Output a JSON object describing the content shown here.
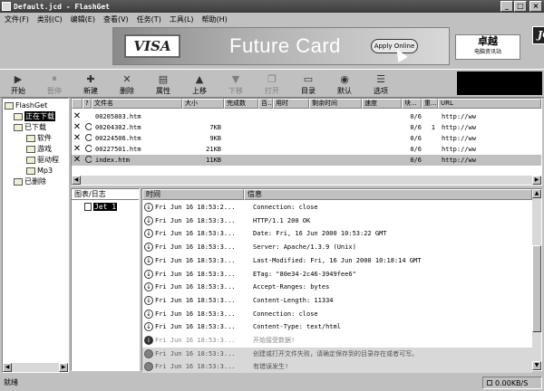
{
  "window": {
    "title": "Default.jcd - FlashGet",
    "buttons": [
      "_",
      "□",
      "×"
    ]
  },
  "menu": [
    "文件(F)",
    "类别(C)",
    "编辑(E)",
    "查看(V)",
    "任务(T)",
    "工具(L)",
    "帮助(H)"
  ],
  "banner": {
    "visa": "VISA",
    "headline": "Future Card",
    "apply": "Apply Online",
    "jc_logo": "JC",
    "zhuoyue_big": "卓越",
    "zhuoyue_small": "电脑资讯站"
  },
  "toolbar": [
    {
      "label": "开始",
      "icon": "play-icon",
      "glyph": "▶",
      "enabled": true
    },
    {
      "label": "暂停",
      "icon": "pause-icon",
      "glyph": "⏸",
      "enabled": false
    },
    {
      "label": "新建",
      "icon": "new-icon",
      "glyph": "✚",
      "enabled": true
    },
    {
      "label": "删除",
      "icon": "delete-icon",
      "glyph": "✕",
      "enabled": true
    },
    {
      "label": "属性",
      "icon": "properties-icon",
      "glyph": "▤",
      "enabled": true
    },
    {
      "label": "上移",
      "icon": "move-up-icon",
      "glyph": "▲",
      "enabled": true
    },
    {
      "label": "下移",
      "icon": "move-down-icon",
      "glyph": "▼",
      "enabled": false
    },
    {
      "label": "打开",
      "icon": "open-icon",
      "glyph": "❐",
      "enabled": false
    },
    {
      "label": "目录",
      "icon": "folder-icon",
      "glyph": "▭",
      "enabled": true
    },
    {
      "label": "默认",
      "icon": "default-icon",
      "glyph": "◉",
      "enabled": true
    },
    {
      "label": "选项",
      "icon": "options-icon",
      "glyph": "☰",
      "enabled": true
    }
  ],
  "tree": [
    {
      "label": "FlashGet",
      "level": 0,
      "selected": false
    },
    {
      "label": "正在下载",
      "level": 1,
      "selected": true
    },
    {
      "label": "已下载",
      "level": 1,
      "selected": false
    },
    {
      "label": "软件",
      "level": 2,
      "selected": false
    },
    {
      "label": "游戏",
      "level": 2,
      "selected": false
    },
    {
      "label": "驱动程",
      "level": 2,
      "selected": false
    },
    {
      "label": "Mp3",
      "level": 2,
      "selected": false
    },
    {
      "label": "已删除",
      "level": 1,
      "selected": false
    }
  ],
  "filelist": {
    "columns": [
      "",
      "?",
      "文件名",
      "大小",
      "完成数",
      "百...",
      "用时",
      "剩余时间",
      "速度",
      "块...",
      "重...",
      "URL"
    ],
    "rows": [
      {
        "name": "00205803.htm",
        "size": "",
        "blocks": "0/6",
        "retry": "",
        "url": "http://ww",
        "circle": false,
        "selected": false
      },
      {
        "name": "00204302.htm",
        "size": "7KB",
        "blocks": "0/6",
        "retry": "1",
        "url": "http://ww",
        "circle": true,
        "selected": false
      },
      {
        "name": "00224506.htm",
        "size": "9KB",
        "blocks": "0/6",
        "retry": "",
        "url": "http://ww",
        "circle": true,
        "selected": false
      },
      {
        "name": "00227501.htm",
        "size": "21KB",
        "blocks": "0/6",
        "retry": "",
        "url": "http://ww",
        "circle": true,
        "selected": false
      },
      {
        "name": "index.htm",
        "size": "11KB",
        "blocks": "0/6",
        "retry": "",
        "url": "http://ww",
        "circle": true,
        "selected": true
      }
    ]
  },
  "logtree": {
    "header": "图表/日志",
    "job": "Jet 1"
  },
  "log": {
    "columns": [
      "时间",
      "信息"
    ],
    "rows": [
      {
        "time": "Fri Jun 16 18:53:2...",
        "msg": "Connection: close",
        "kind": "recv"
      },
      {
        "time": "Fri Jun 16 18:53:3...",
        "msg": "HTTP/1.1 200 OK",
        "kind": "recv"
      },
      {
        "time": "Fri Jun 16 18:53:3...",
        "msg": "Date: Fri, 16 Jun 2000 10:53:22 GMT",
        "kind": "recv"
      },
      {
        "time": "Fri Jun 16 18:53:3...",
        "msg": "Server: Apache/1.3.9 (Unix)",
        "kind": "recv"
      },
      {
        "time": "Fri Jun 16 18:53:3...",
        "msg": "Last-Modified: Fri, 16 Jun 2000 10:18:14 GMT",
        "kind": "recv"
      },
      {
        "time": "Fri Jun 16 18:53:3...",
        "msg": "ETag: \"80e34-2c46-3949fee6\"",
        "kind": "recv"
      },
      {
        "time": "Fri Jun 16 18:53:3...",
        "msg": "Accept-Ranges: bytes",
        "kind": "recv"
      },
      {
        "time": "Fri Jun 16 18:53:3...",
        "msg": "Content-Length: 11334",
        "kind": "recv"
      },
      {
        "time": "Fri Jun 16 18:53:3...",
        "msg": "Connection: close",
        "kind": "recv"
      },
      {
        "time": "Fri Jun 16 18:53:3...",
        "msg": "Content-Type: text/html",
        "kind": "recv"
      },
      {
        "time": "Fri Jun 16 18:53:3...",
        "msg": "开始接受数据!",
        "kind": "info"
      },
      {
        "time": "Fri Jun 16 18:53:3...",
        "msg": "创建或打开文件失败，请确定保存到的目录存在或者可写。",
        "kind": "err"
      },
      {
        "time": "Fri Jun 16 18:53:3...",
        "msg": "有错误发生!",
        "kind": "err"
      }
    ]
  },
  "status": {
    "text": "就绪",
    "speed": "0.00KB/S"
  }
}
